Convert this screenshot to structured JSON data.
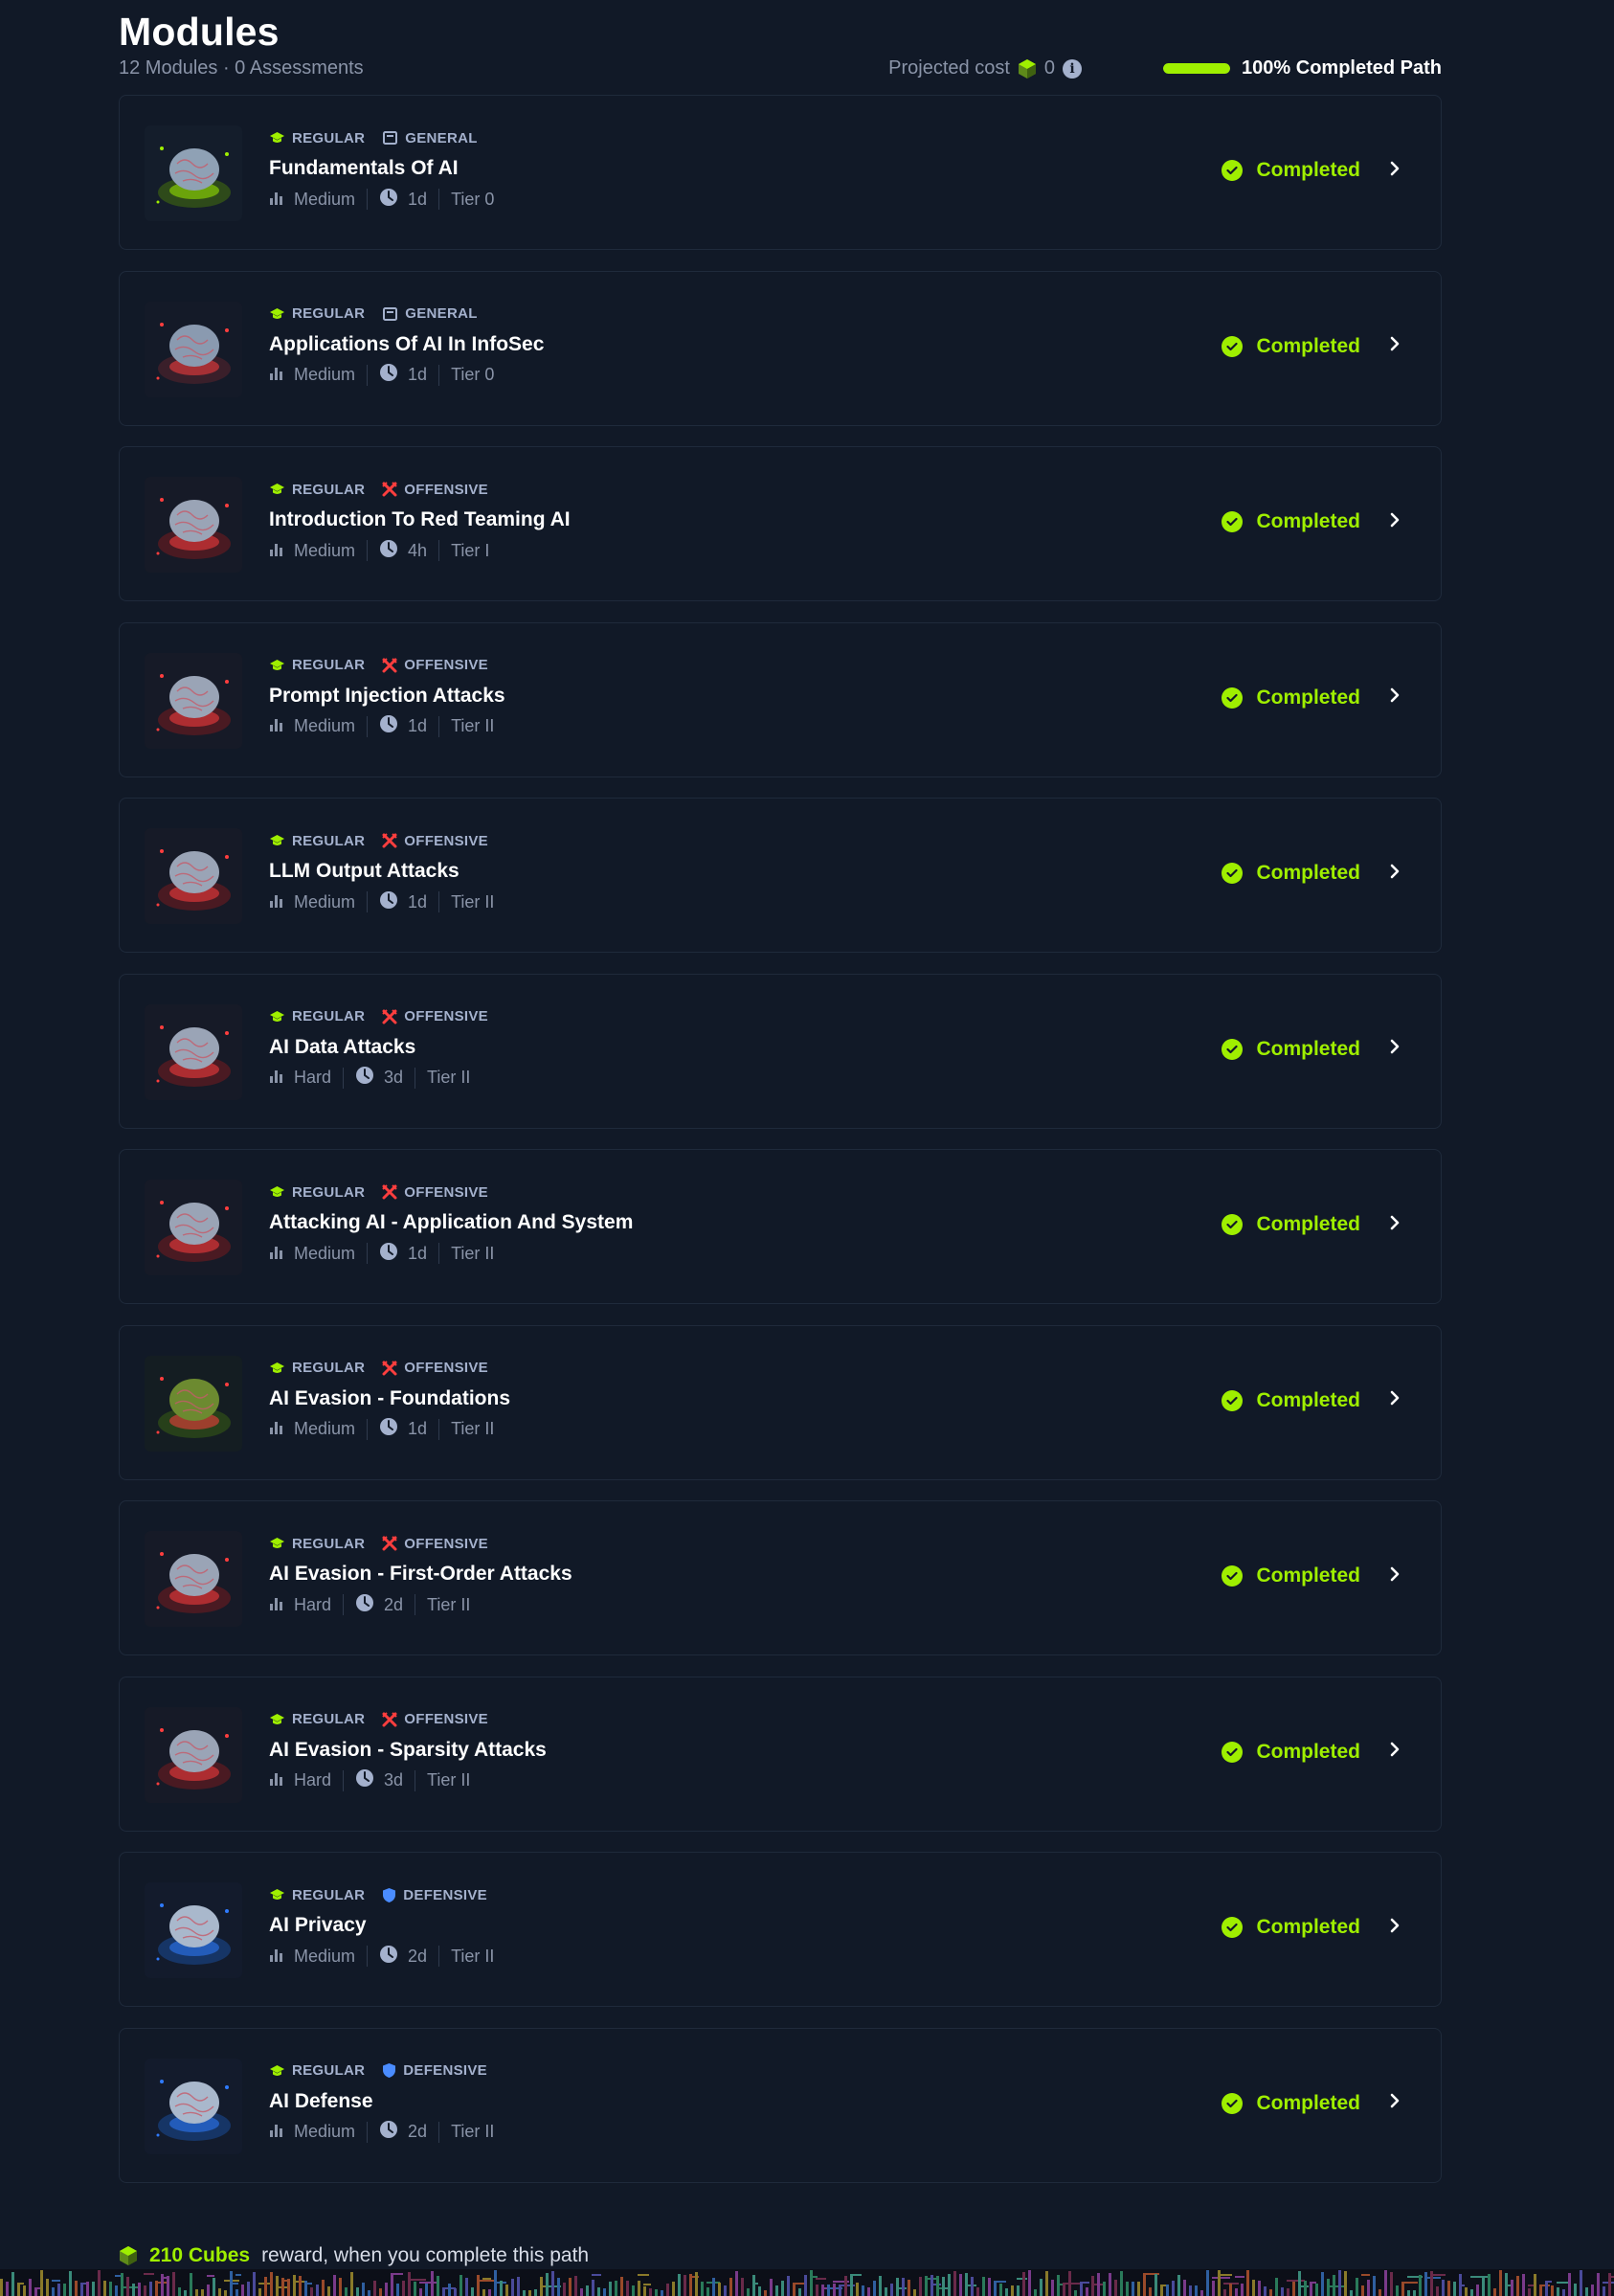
{
  "header": {
    "title": "Modules",
    "subtitle": "12 Modules · 0 Assessments",
    "projected_label": "Projected cost",
    "projected_value": "0",
    "info_glyph": "i",
    "path_progress": 1.0,
    "path_progress_label": "100% Completed Path"
  },
  "colors": {
    "background": "#111927",
    "accent_green": "#9fef00",
    "offensive_red": "#ff3e3e",
    "defensive_blue": "#4a8cff",
    "muted_text": "#a4b1cd"
  },
  "modules": [
    {
      "type": "REGULAR",
      "category": "GENERAL",
      "category_icon": "book-icon",
      "title": "Fundamentals Of AI",
      "difficulty": "Medium",
      "duration": "1d",
      "tier": "Tier 0",
      "status": "Completed",
      "thumb": "green"
    },
    {
      "type": "REGULAR",
      "category": "GENERAL",
      "category_icon": "book-icon",
      "title": "Applications Of AI In InfoSec",
      "difficulty": "Medium",
      "duration": "1d",
      "tier": "Tier 0",
      "status": "Completed",
      "thumb": "redblue"
    },
    {
      "type": "REGULAR",
      "category": "OFFENSIVE",
      "category_icon": "crossed-swords-icon",
      "title": "Introduction To Red Teaming AI",
      "difficulty": "Medium",
      "duration": "4h",
      "tier": "Tier I",
      "status": "Completed",
      "thumb": "red"
    },
    {
      "type": "REGULAR",
      "category": "OFFENSIVE",
      "category_icon": "crossed-swords-icon",
      "title": "Prompt Injection Attacks",
      "difficulty": "Medium",
      "duration": "1d",
      "tier": "Tier II",
      "status": "Completed",
      "thumb": "red"
    },
    {
      "type": "REGULAR",
      "category": "OFFENSIVE",
      "category_icon": "crossed-swords-icon",
      "title": "LLM Output Attacks",
      "difficulty": "Medium",
      "duration": "1d",
      "tier": "Tier II",
      "status": "Completed",
      "thumb": "red"
    },
    {
      "type": "REGULAR",
      "category": "OFFENSIVE",
      "category_icon": "crossed-swords-icon",
      "title": "AI Data Attacks",
      "difficulty": "Hard",
      "duration": "3d",
      "tier": "Tier II",
      "status": "Completed",
      "thumb": "red"
    },
    {
      "type": "REGULAR",
      "category": "OFFENSIVE",
      "category_icon": "crossed-swords-icon",
      "title": "Attacking AI - Application And System",
      "difficulty": "Medium",
      "duration": "1d",
      "tier": "Tier II",
      "status": "Completed",
      "thumb": "red"
    },
    {
      "type": "REGULAR",
      "category": "OFFENSIVE",
      "category_icon": "crossed-swords-icon",
      "title": "AI Evasion - Foundations",
      "difficulty": "Medium",
      "duration": "1d",
      "tier": "Tier II",
      "status": "Completed",
      "thumb": "greenred"
    },
    {
      "type": "REGULAR",
      "category": "OFFENSIVE",
      "category_icon": "crossed-swords-icon",
      "title": "AI Evasion - First-Order Attacks",
      "difficulty": "Hard",
      "duration": "2d",
      "tier": "Tier II",
      "status": "Completed",
      "thumb": "red"
    },
    {
      "type": "REGULAR",
      "category": "OFFENSIVE",
      "category_icon": "crossed-swords-icon",
      "title": "AI Evasion - Sparsity Attacks",
      "difficulty": "Hard",
      "duration": "3d",
      "tier": "Tier II",
      "status": "Completed",
      "thumb": "red"
    },
    {
      "type": "REGULAR",
      "category": "DEFENSIVE",
      "category_icon": "shield-icon",
      "title": "AI Privacy",
      "difficulty": "Medium",
      "duration": "2d",
      "tier": "Tier II",
      "status": "Completed",
      "thumb": "blue"
    },
    {
      "type": "REGULAR",
      "category": "DEFENSIVE",
      "category_icon": "shield-icon",
      "title": "AI Defense",
      "difficulty": "Medium",
      "duration": "2d",
      "tier": "Tier II",
      "status": "Completed",
      "thumb": "blue"
    }
  ],
  "footer": {
    "reward_amount": "210 Cubes",
    "reward_text": "reward, when you complete this path"
  }
}
